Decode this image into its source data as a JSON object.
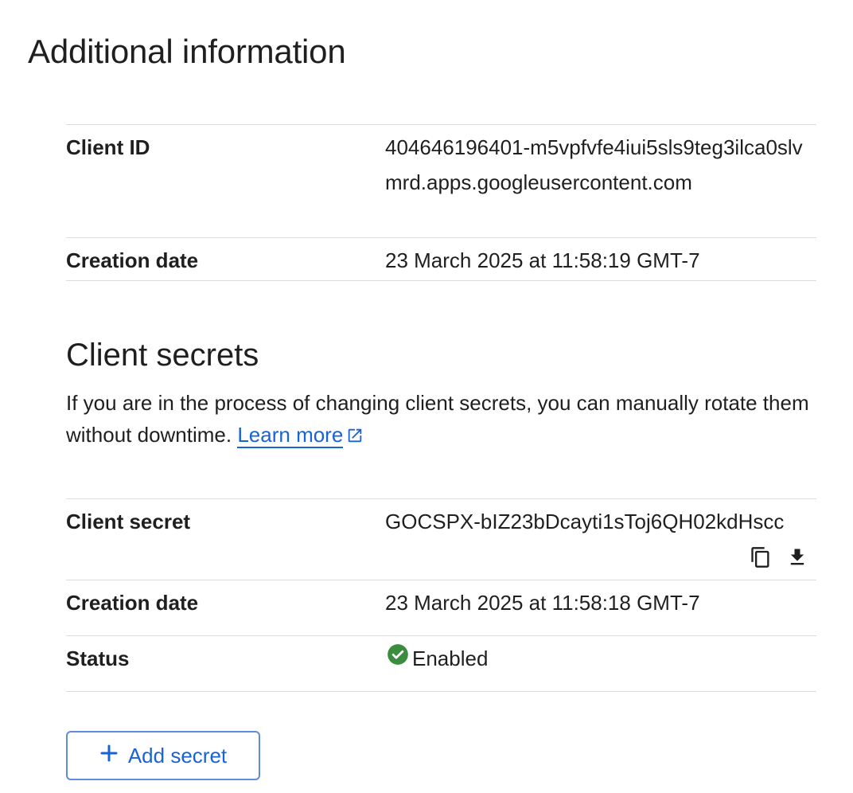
{
  "page": {
    "title": "Additional information"
  },
  "client_info": {
    "client_id_label": "Client ID",
    "client_id_value": "404646196401-m5vpfvfe4iui5sls9teg3ilca0slvmrd.apps.googleusercontent.com",
    "creation_date_label": "Creation date",
    "creation_date_value": "23 March 2025 at 11:58:19 GMT-7"
  },
  "client_secrets": {
    "title": "Client secrets",
    "description": "If you are in the process of changing client secrets, you can manually rotate them without downtime.",
    "learn_more_label": "Learn more",
    "secret_label": "Client secret",
    "secret_value": "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",
    "creation_date_label": "Creation date",
    "creation_date_value": "23 March 2025 at 11:58:18 GMT-7",
    "status_label": "Status",
    "status_value": "Enabled",
    "add_secret_label": "Add secret"
  },
  "icons": {
    "copy": "copy-icon",
    "download": "download-icon",
    "status": "check-circle-icon",
    "external": "external-link-icon",
    "add": "plus-icon"
  },
  "colors": {
    "link": "#1a63d6",
    "status_ok": "#3a8d3e",
    "divider": "#dadce0",
    "text": "#1f1f1f"
  }
}
